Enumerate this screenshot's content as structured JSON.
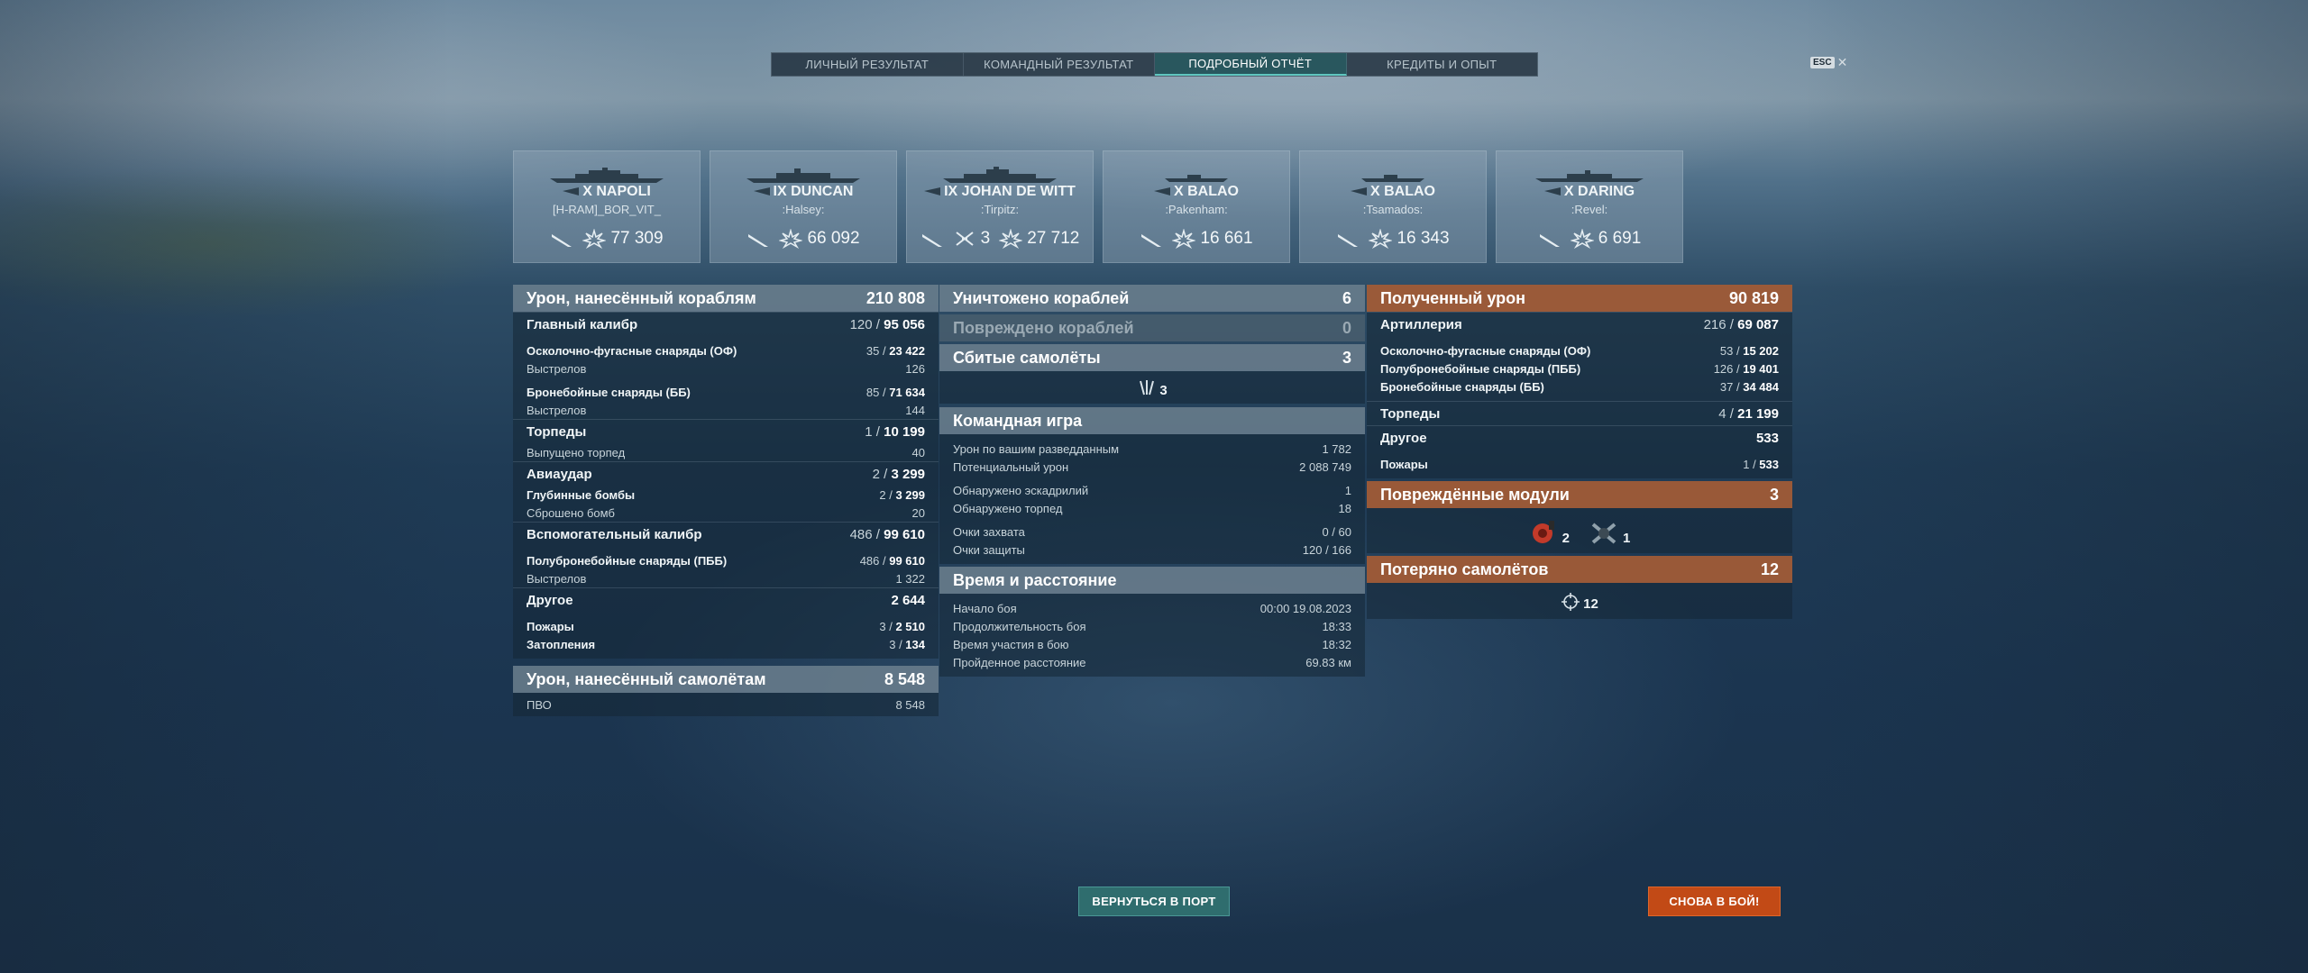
{
  "tabs": [
    {
      "label": "ЛИЧНЫЙ РЕЗУЛЬТАТ"
    },
    {
      "label": "КОМАНДНЫЙ РЕЗУЛЬТАТ"
    },
    {
      "label": "ПОДРОБНЫЙ ОТЧЁТ",
      "active": true
    },
    {
      "label": "КРЕДИТЫ И ОПЫТ"
    }
  ],
  "esc_label": "ESC",
  "ships": [
    {
      "name": "X NAPOLI",
      "player": "[H-RAM]_BOR_VIT_",
      "damage": "77 309"
    },
    {
      "name": "IX DUNCAN",
      "player": ":Halsey:",
      "damage": "66 092"
    },
    {
      "name": "IX JOHAN DE WITT",
      "player": ":Tirpitz:",
      "planes": "3",
      "damage": "27 712"
    },
    {
      "name": "X BALAO",
      "player": ":Pakenham:",
      "damage": "16 661"
    },
    {
      "name": "X BALAO",
      "player": ":Tsamados:",
      "damage": "16 343"
    },
    {
      "name": "X DARING",
      "player": ":Revel:",
      "damage": "6 691"
    }
  ],
  "left": {
    "ships_damage": {
      "label": "Урон, нанесённый кораблям",
      "value": "210 808"
    },
    "main_caliber": {
      "label": "Главный калибр",
      "hits": "120",
      "dmg": "95 056"
    },
    "he": {
      "label": "Осколочно-фугасные снаряды (ОФ)",
      "hits": "35",
      "dmg": "23 422"
    },
    "he_shots": {
      "label": "Выстрелов",
      "value": "126"
    },
    "ap": {
      "label": "Бронебойные снаряды (ББ)",
      "hits": "85",
      "dmg": "71 634"
    },
    "ap_shots": {
      "label": "Выстрелов",
      "value": "144"
    },
    "torpedoes": {
      "label": "Торпеды",
      "hits": "1",
      "dmg": "10 199"
    },
    "torp_launched": {
      "label": "Выпущено торпед",
      "value": "40"
    },
    "airstrike": {
      "label": "Авиаудар",
      "hits": "2",
      "dmg": "3 299"
    },
    "depth": {
      "label": "Глубинные бомбы",
      "hits": "2",
      "dmg": "3 299"
    },
    "bombs": {
      "label": "Сброшено бомб",
      "value": "20"
    },
    "secondary": {
      "label": "Вспомогательный калибр",
      "hits": "486",
      "dmg": "99 610"
    },
    "sap": {
      "label": "Полубронебойные снаряды (ПББ)",
      "hits": "486",
      "dmg": "99 610"
    },
    "sap_shots": {
      "label": "Выстрелов",
      "value": "1 322"
    },
    "other": {
      "label": "Другое",
      "value": "2 644"
    },
    "fires": {
      "label": "Пожары",
      "hits": "3",
      "dmg": "2 510"
    },
    "floods": {
      "label": "Затопления",
      "hits": "3",
      "dmg": "134"
    },
    "planes_damage": {
      "label": "Урон, нанесённый самолётам",
      "value": "8 548"
    },
    "aa": {
      "label": "ПВО",
      "value": "8 548"
    }
  },
  "middle": {
    "destroyed": {
      "label": "Уничтожено кораблей",
      "value": "6"
    },
    "damaged": {
      "label": "Повреждено кораблей",
      "value": "0"
    },
    "shot_planes": {
      "label": "Сбитые самолёты",
      "value": "3"
    },
    "shot_planes_icon_count": "3",
    "team": {
      "label": "Командная игра"
    },
    "spotting": {
      "label": "Урон по вашим разведданным",
      "value": "1 782"
    },
    "potential": {
      "label": "Потенциальный урон",
      "value": "2 088 749"
    },
    "squadrons": {
      "label": "Обнаружено эскадрилий",
      "value": "1"
    },
    "torps_spotted": {
      "label": "Обнаружено торпед",
      "value": "18"
    },
    "capture": {
      "label": "Очки захвата",
      "value": "0 / 60"
    },
    "defense": {
      "label": "Очки защиты",
      "value": "120 / 166"
    },
    "time": {
      "label": "Время и расстояние"
    },
    "start": {
      "label": "Начало боя",
      "value": "00:00  19.08.2023"
    },
    "duration": {
      "label": "Продолжительность боя",
      "value": "18:33"
    },
    "participation": {
      "label": "Время участия в бою",
      "value": "18:32"
    },
    "distance": {
      "label": "Пройденное расстояние",
      "value": "69.83 км"
    }
  },
  "right": {
    "received": {
      "label": "Полученный урон",
      "value": "90 819"
    },
    "artillery": {
      "label": "Артиллерия",
      "hits": "216",
      "dmg": "69 087"
    },
    "he": {
      "label": "Осколочно-фугасные снаряды (ОФ)",
      "hits": "53",
      "dmg": "15 202"
    },
    "sap": {
      "label": "Полубронебойные снаряды (ПББ)",
      "hits": "126",
      "dmg": "19 401"
    },
    "ap": {
      "label": "Бронебойные снаряды (ББ)",
      "hits": "37",
      "dmg": "34 484"
    },
    "torpedoes": {
      "label": "Торпеды",
      "hits": "4",
      "dmg": "21 199"
    },
    "other": {
      "label": "Другое",
      "value": "533"
    },
    "fires": {
      "label": "Пожары",
      "hits": "1",
      "dmg": "533"
    },
    "modules": {
      "label": "Повреждённые модули",
      "value": "3"
    },
    "module_a": "2",
    "module_b": "1",
    "lost_planes": {
      "label": "Потеряно самолётов",
      "value": "12"
    },
    "lost_planes_icon_count": "12"
  },
  "buttons": {
    "port": "ВЕРНУТЬСЯ В ПОРТ",
    "battle": "СНОВА В БОЙ!"
  },
  "colors": {
    "accent_teal": "#2f6d6e",
    "accent_orange": "#c24a16",
    "received_header": "#b06036"
  }
}
